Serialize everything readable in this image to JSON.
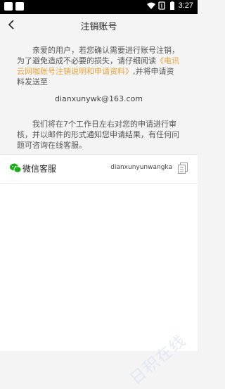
{
  "status_bar": {
    "time": "3:27"
  },
  "nav": {
    "title": "注销账号",
    "back_icon": "chevron-left-icon"
  },
  "notice": {
    "para1_pre": "亲爱的用户，若您确认需要进行账号注销，为了避免造成不必要的损失，请仔细阅读",
    "para1_link": "《电讯云网咖账号注销说明和申请资料》",
    "para1_post": ",并将申请资料发送至",
    "email": "dianxunywk@163.com",
    "para2": "我们将在7个工作日左右对您的申请进行审核，并以邮件的形式通知您申请结果，有任何问题可咨询在线客服。"
  },
  "wechat": {
    "label": "微信客服",
    "id": "dianxunyunwangka",
    "icon": "wechat-icon",
    "copy_icon": "copy-icon"
  },
  "watermark": "日积在线",
  "colors": {
    "link": "#e4a43b",
    "background": "#f4f4f4",
    "wechat_green": "#1aad19"
  }
}
